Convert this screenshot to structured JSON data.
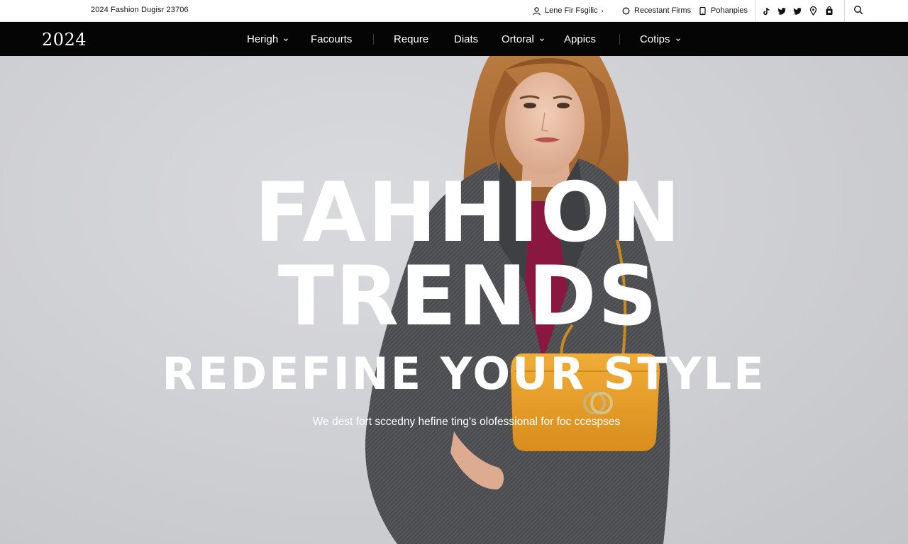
{
  "topbar": {
    "promo": "2024 Fashion Dugisr 23706",
    "utility": [
      {
        "icon": "user-icon",
        "label": "Lene Fir Fsgilic"
      },
      {
        "icon": "circle-icon",
        "label": "Recestant Firms"
      },
      {
        "icon": "phone-icon",
        "label": "Pohanpies"
      }
    ],
    "social": [
      "tiktok-icon",
      "twitter-icon",
      "twitter-icon",
      "location-pin-icon",
      "bag-icon"
    ],
    "search_icon": "search-icon"
  },
  "nav": {
    "logo": "2024",
    "items": [
      {
        "label": "Herigh",
        "dropdown": true
      },
      {
        "label": "Facourts",
        "dropdown": false
      },
      {
        "label": "Requre",
        "dropdown": false
      },
      {
        "label": "Diats",
        "dropdown": false
      },
      {
        "label": "Ortoral",
        "dropdown": true
      },
      {
        "label": "Appics",
        "dropdown": false
      },
      {
        "label": "Cotips",
        "dropdown": true
      }
    ]
  },
  "hero": {
    "line1": "FAHHION",
    "line2": "TRENDS",
    "line3": "REDEFINE YOUR STYLE",
    "tagline": "We dest fort sccedny hefine ting's olofessional for foc ccespses"
  },
  "colors": {
    "topbar_bg": "#ffffff",
    "nav_bg": "#050505",
    "hero_bg": "#cfd0d4",
    "coat": "#4a4b4e",
    "bag": "#e9a22c",
    "top_inner": "#8a1740",
    "hair": "#a9682f"
  }
}
